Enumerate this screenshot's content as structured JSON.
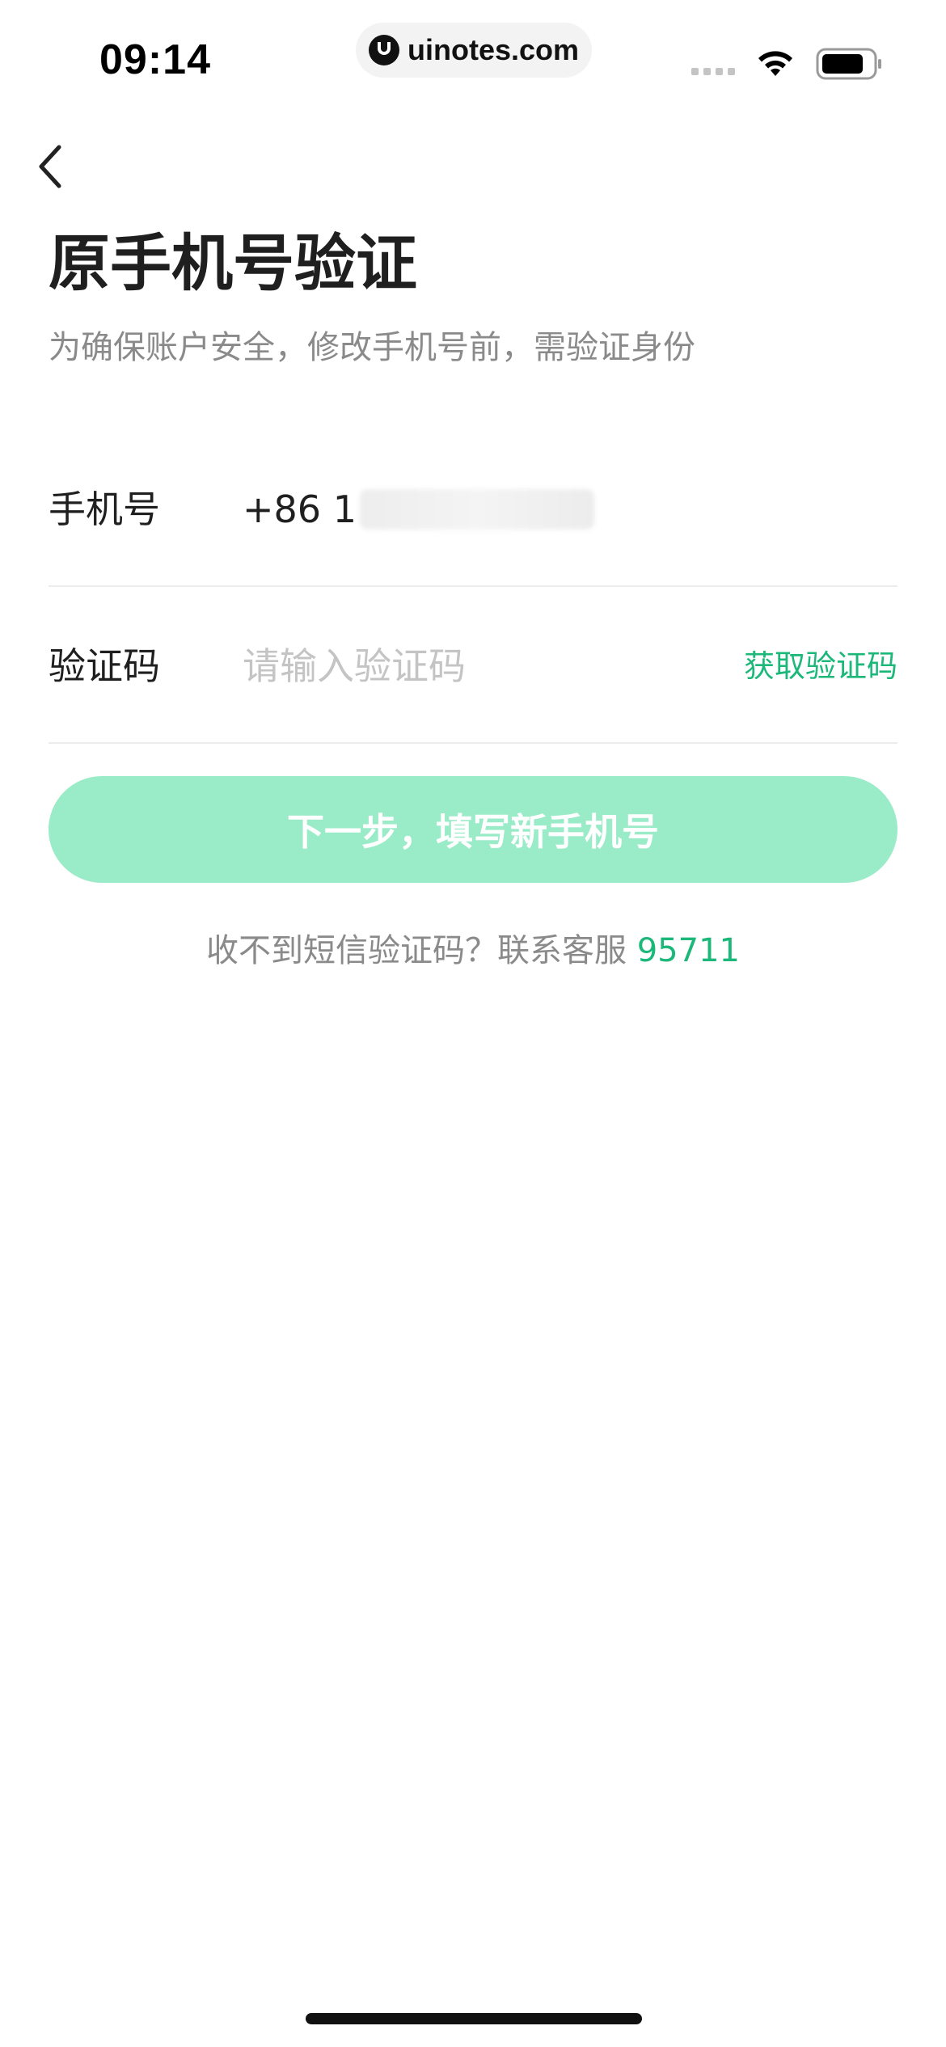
{
  "status_bar": {
    "time": "09:14",
    "url": "uinotes.com",
    "icons": [
      "signal-icon",
      "wifi-icon",
      "battery-icon"
    ]
  },
  "nav": {
    "back_icon": "chevron-left-icon"
  },
  "header": {
    "title": "原手机号验证",
    "subtitle": "为确保账户安全，修改手机号前，需验证身份"
  },
  "form": {
    "phone": {
      "label": "手机号",
      "value": "+86 1"
    },
    "code": {
      "label": "验证码",
      "placeholder": "请输入验证码",
      "value": "",
      "get_code_label": "获取验证码"
    }
  },
  "next_button": {
    "label": "下一步，填写新手机号"
  },
  "help": {
    "text": "收不到短信验证码？联系客服",
    "phone": "95711"
  },
  "colors": {
    "accent": "#1cb87a",
    "button_disabled": "#9aebc8",
    "text_primary": "#1f1f1f",
    "text_secondary": "#8a8a8a",
    "placeholder": "#c4c4c4",
    "divider": "#ececec"
  }
}
